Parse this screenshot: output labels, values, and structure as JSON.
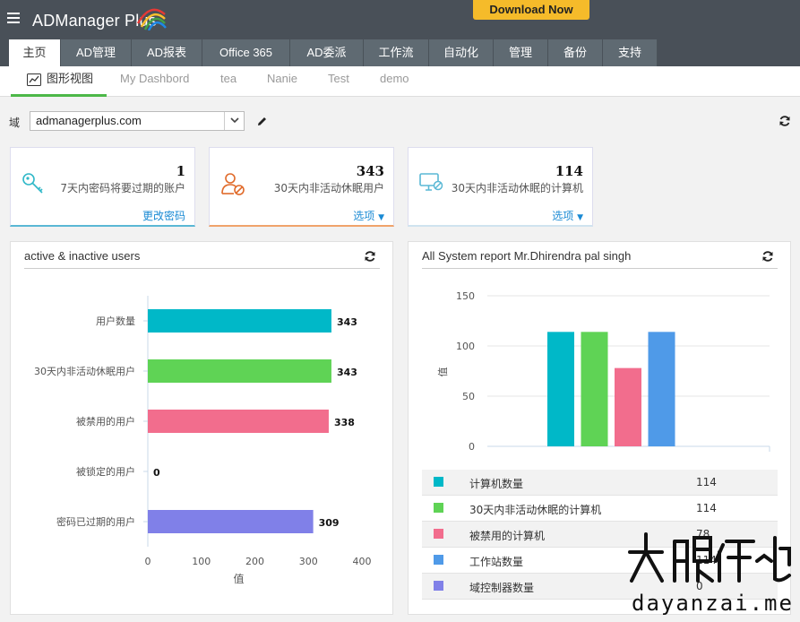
{
  "header": {
    "logo_text": "ADManager Plus",
    "download_label": "Download Now"
  },
  "colors": {
    "topbar": "#495058",
    "accent_green": "#4cb848",
    "download": "#f5bb2a",
    "link": "#1a8ad4"
  },
  "main_tabs": [
    "主页",
    "AD管理",
    "AD报表",
    "Office 365",
    "AD委派",
    "工作流",
    "自动化",
    "管理",
    "备份",
    "支持"
  ],
  "sub_tabs": [
    "图形视图",
    "My Dashbord",
    "tea",
    "Nanie",
    "Test",
    "demo"
  ],
  "domain": {
    "label": "域",
    "value": "admanagerplus.com"
  },
  "cards": [
    {
      "icon": "key-icon",
      "number": "1",
      "desc": "7天内密码将要过期的账户",
      "link": "更改密码"
    },
    {
      "icon": "user-disabled-icon",
      "number": "343",
      "desc": "30天内非活动休眠用户",
      "link": "选项"
    },
    {
      "icon": "computer-disabled-icon",
      "number": "114",
      "desc": "30天内非活动休眠的计算机",
      "link": "选项"
    }
  ],
  "panel_left": {
    "title": "active & inactive users"
  },
  "panel_right": {
    "title": "All System report Mr.Dhirendra pal singh"
  },
  "chart_data": [
    {
      "type": "bar",
      "orientation": "horizontal",
      "categories": [
        "用户数量",
        "30天内非活动休眠用户",
        "被禁用的用户",
        "被锁定的用户",
        "密码已过期的用户"
      ],
      "values": [
        343,
        343,
        338,
        0,
        309
      ],
      "colors": [
        "#00b8c8",
        "#5fd355",
        "#f26d8d",
        "#00b8c8",
        "#8080e8"
      ],
      "xlabel": "值",
      "xlim": [
        0,
        400
      ],
      "xticks": [
        0,
        100,
        200,
        300,
        400
      ],
      "grid": false
    },
    {
      "type": "bar",
      "categories": [
        "计算机数量",
        "30天内非活动休眠的计算机",
        "被禁用的计算机",
        "工作站数量",
        "域控制器数量"
      ],
      "values": [
        114,
        114,
        78,
        114,
        0
      ],
      "colors": [
        "#00b8c8",
        "#5fd355",
        "#f26d8d",
        "#4f9ae8",
        "#8080e8"
      ],
      "ylabel": "值",
      "ylim": [
        0,
        150
      ],
      "yticks": [
        0,
        50,
        100,
        150
      ],
      "grid": true,
      "legend": "table-bottom",
      "legend_values": [
        "114",
        "114",
        "78",
        "114",
        "0"
      ]
    }
  ],
  "watermark": {
    "text": "大眼仔~旭",
    "url": "dayanzai.me"
  }
}
